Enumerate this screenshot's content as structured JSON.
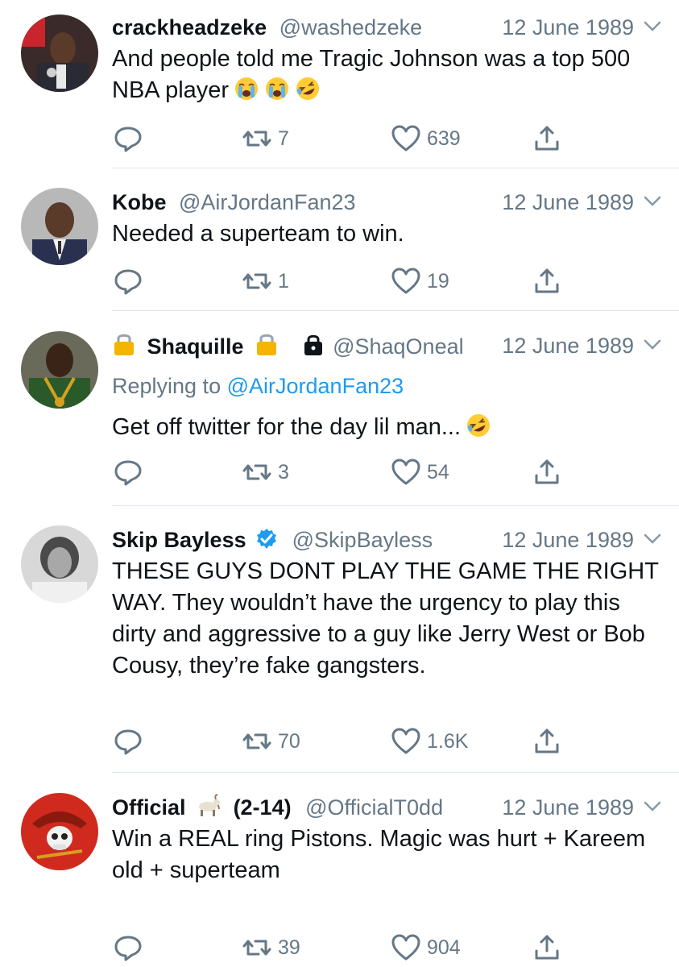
{
  "tweets": [
    {
      "name": "crackheadzeke",
      "handle": "@washedzeke",
      "date": "12 June 1989",
      "text": "And people told me Tragic Johnson was a top 500 NBA player",
      "emojis": [
        "loudly-crying-face",
        "loudly-crying-face",
        "rolling-on-floor-laughing"
      ],
      "retweets": "7",
      "likes": "639"
    },
    {
      "name": "Kobe",
      "handle": "@AirJordanFan23",
      "date": "12 June 1989",
      "text": "Needed a superteam to win.",
      "retweets": "1",
      "likes": "19"
    },
    {
      "name": "Shaquille",
      "name_icons": [
        "lock-emoji",
        "lock-emoji"
      ],
      "protected_icon": "protected-lock-icon",
      "handle": "@ShaqOneal",
      "date": "12 June 1989",
      "replying_label": "Replying to",
      "replying_to": "@AirJordanFan23",
      "text": "Get off twitter for the day lil man...",
      "emojis": [
        "rolling-on-floor-laughing"
      ],
      "retweets": "3",
      "likes": "54"
    },
    {
      "name": "Skip Bayless",
      "verified": true,
      "handle": "@SkipBayless",
      "date": "12 June 1989",
      "text": "THESE GUYS DONT PLAY THE GAME THE RIGHT WAY. They wouldn’t have the urgency to play this dirty and aggressive to a guy like Jerry West or Bob Cousy, they’re fake gangsters.",
      "retweets": "70",
      "likes": "1.6K"
    },
    {
      "name": "Official",
      "name_icon": "goat-emoji",
      "name_suffix": "(2-14)",
      "handle": "@OfficialT0dd",
      "date": "12 June 1989",
      "text": "Win a REAL ring Pistons. Magic was hurt + Kareem old + superteam",
      "retweets": "39",
      "likes": "904"
    }
  ],
  "colors": {
    "text": "#0f1419",
    "muted": "#657786",
    "link": "#1d9bf0",
    "divider": "#e1e8ed",
    "verified": "#1d9bf0"
  }
}
